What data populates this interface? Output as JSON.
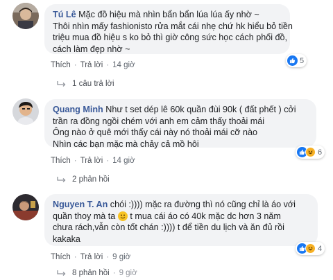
{
  "comments": [
    {
      "author": "Tú Lê",
      "lines": [
        "Mặc đồ hiệu mà nhìn bẩn bẩn lúa lúa ấy nhờ ~",
        "Thôi nhìn mấy fashionisto rửa mắt cái nhẹ chứ hk hiểu bỏ tiền",
        "triệu mua đồ hiệu s ko bỏ thì giờ công sức học cách phối đồ,",
        "cách làm đẹp nhờ ~"
      ],
      "reaction_count": "5",
      "reaction_types": [
        "like"
      ],
      "like_label": "Thích",
      "time": "14 giờ",
      "replies_label": "1 câu trả lời"
    },
    {
      "author": "Quang Minh",
      "lines": [
        "Như t set dép lê 60k quần đùi 90k ( đất phết ) cởi",
        "trần ra đồng ngồi chém với anh em cảm thấy thoải mái",
        "Ông nào ở quê mới thấy cái này nó thoải mái cỡ nào",
        "Nhìn các bạn mặc mà chảy cả mồ hôi"
      ],
      "reaction_count": "6",
      "reaction_types": [
        "like",
        "haha"
      ],
      "like_label": "Thích",
      "time": "14 giờ",
      "replies_label": "2 phản hồi"
    },
    {
      "author": "Nguyen T. An",
      "lines": [
        "chói :)))) mặc ra đường thì nó cũng chỉ là áo với",
        "quần thoy mà ta",
        "t mua cái áo có 40k mặc dc hơn 3 năm",
        "chưa rách,vẫn còn tốt chán :)))) t để tiền du lịch và ăn đủ rồi",
        "kakaka"
      ],
      "reaction_count": "4",
      "reaction_types": [
        "like",
        "haha"
      ],
      "like_label": "Thích",
      "time": "9 giờ",
      "replies_label": "8 phản hồi"
    }
  ],
  "reply_dot_label": "Trả lời"
}
